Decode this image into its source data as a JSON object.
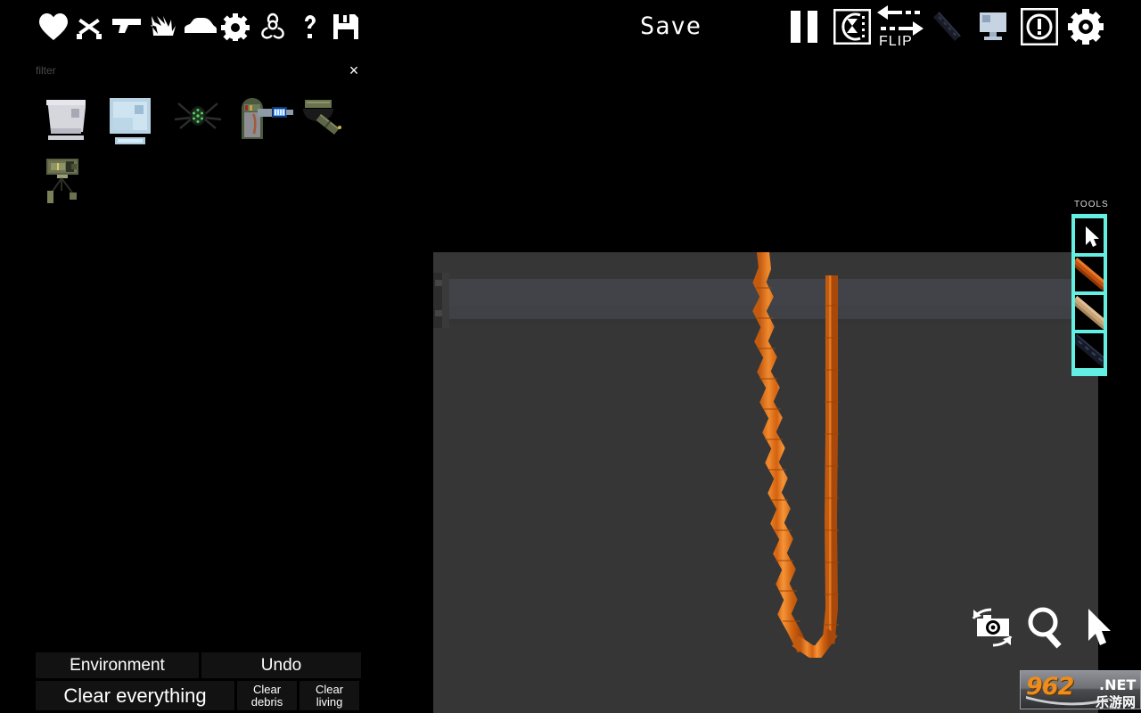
{
  "app": {
    "title": "Level Editor",
    "background_color": "#000000",
    "canvas_color": "#363636",
    "accent_color": "#63f0e3"
  },
  "topbar": {
    "icons": [
      {
        "name": "heart-icon",
        "label": "Health / Life"
      },
      {
        "name": "weapons-icon",
        "label": "Weapons"
      },
      {
        "name": "gun-icon",
        "label": "Guns"
      },
      {
        "name": "explosion-icon",
        "label": "Explosives"
      },
      {
        "name": "vehicle-icon",
        "label": "Vehicles"
      },
      {
        "name": "gear-icon",
        "label": "Machines"
      },
      {
        "name": "biohazard-icon",
        "label": "Hazards"
      },
      {
        "name": "question-icon",
        "label": "Misc"
      },
      {
        "name": "floppy-icon",
        "label": "Saved Items"
      }
    ],
    "save_label": "Save",
    "controls": [
      {
        "name": "pause-button",
        "label": "Pause"
      },
      {
        "name": "physics-button",
        "label": "Physics"
      },
      {
        "name": "flip-button",
        "label": "FLIP"
      },
      {
        "name": "beam-button",
        "label": "Beam"
      },
      {
        "name": "screen-button",
        "label": "Display"
      },
      {
        "name": "warning-button",
        "label": "Warning"
      },
      {
        "name": "settings-button",
        "label": "Settings"
      }
    ],
    "flip_label": "FLIP"
  },
  "palette": {
    "filter_placeholder": "filter",
    "filter_value": "",
    "close_label": "×",
    "items": [
      {
        "name": "palette-item-monitor-white",
        "label": "White Monitor"
      },
      {
        "name": "palette-item-monitor-blue",
        "label": "Blue Monitor"
      },
      {
        "name": "palette-item-spider-drone",
        "label": "Spider Drone"
      },
      {
        "name": "palette-item-laser-emitter",
        "label": "Laser Emitter"
      },
      {
        "name": "palette-item-camera",
        "label": "Security Camera"
      },
      {
        "name": "palette-item-tripod-turret",
        "label": "Tripod Turret"
      }
    ]
  },
  "bottom_panel": {
    "environment_label": "Environment",
    "undo_label": "Undo",
    "clear_everything_label": "Clear everything",
    "clear_debris_line1": "Clear",
    "clear_debris_line2": "debris",
    "clear_living_line1": "Clear",
    "clear_living_line2": "living"
  },
  "tools": {
    "label": "TOOLS",
    "border_color": "#63f0e3",
    "items": [
      {
        "name": "tool-select-cursor",
        "label": "Select",
        "selected": true
      },
      {
        "name": "tool-rust-beam",
        "label": "Rust Beam",
        "selected": false
      },
      {
        "name": "tool-wood-beam",
        "label": "Wood Beam",
        "selected": false
      },
      {
        "name": "tool-dark-beam",
        "label": "Dark Beam",
        "selected": false
      }
    ]
  },
  "viewport_controls": [
    {
      "name": "recenter-camera-icon",
      "label": "Recenter Camera"
    },
    {
      "name": "zoom-icon",
      "label": "Zoom"
    },
    {
      "name": "cursor-icon",
      "label": "Cursor"
    }
  ],
  "scene": {
    "rope_color": "#e2701c",
    "rope_highlight": "#f08a2e",
    "rope_shadow": "#b2500d",
    "ropes": [
      {
        "name": "rope-wavy",
        "style": "zigzag"
      },
      {
        "name": "rope-straight",
        "style": "straight"
      }
    ]
  },
  "watermark": {
    "digits_962": "962",
    "dot_net": ".NET",
    "chinese": "乐游网"
  }
}
